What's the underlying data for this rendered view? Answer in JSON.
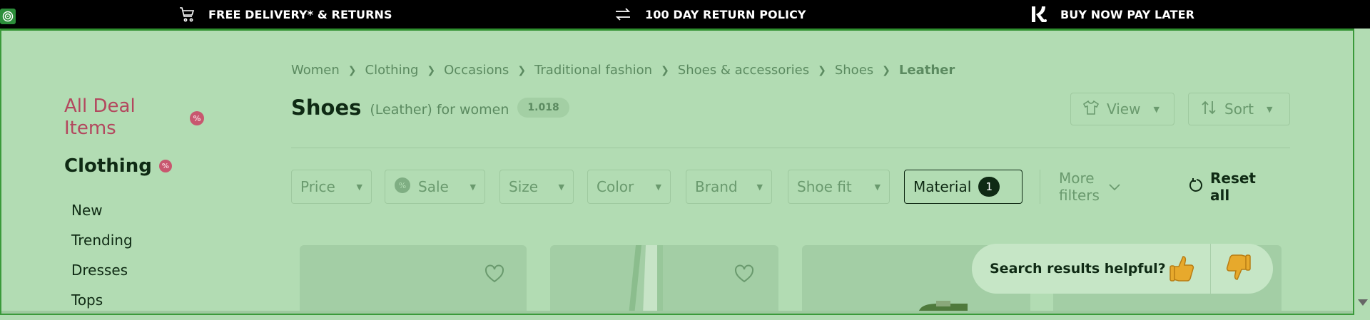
{
  "promo_bar": {
    "items": [
      {
        "icon": "cart-icon",
        "text": "FREE DELIVERY* & RETURNS"
      },
      {
        "icon": "exchange-arrows-icon",
        "text": "100 DAY RETURN POLICY"
      },
      {
        "icon": "klarna-k-icon",
        "text": "BUY NOW PAY LATER"
      }
    ]
  },
  "sidebar": {
    "deal_label": "All Deal Items",
    "category": "Clothing",
    "items": [
      "New",
      "Trending",
      "Dresses",
      "Tops"
    ]
  },
  "breadcrumb": [
    "Women",
    "Clothing",
    "Occasions",
    "Traditional fashion",
    "Shoes & accessories",
    "Shoes",
    "Leather"
  ],
  "header": {
    "title": "Shoes",
    "subtitle": "(Leather) for women",
    "count": "1.018",
    "view_label": "View",
    "sort_label": "Sort"
  },
  "filters": {
    "price": "Price",
    "sale": "Sale",
    "size": "Size",
    "color": "Color",
    "brand": "Brand",
    "shoe_fit": "Shoe fit",
    "material": "Material",
    "material_count": "1",
    "more": "More filters",
    "reset": "Reset all"
  },
  "feedback": {
    "question": "Search results helpful?"
  },
  "colors": {
    "overlay": "#b2dcb3",
    "deal_accent": "#b3475e",
    "text_dark": "#0f2a14",
    "muted": "#5b8a60"
  }
}
